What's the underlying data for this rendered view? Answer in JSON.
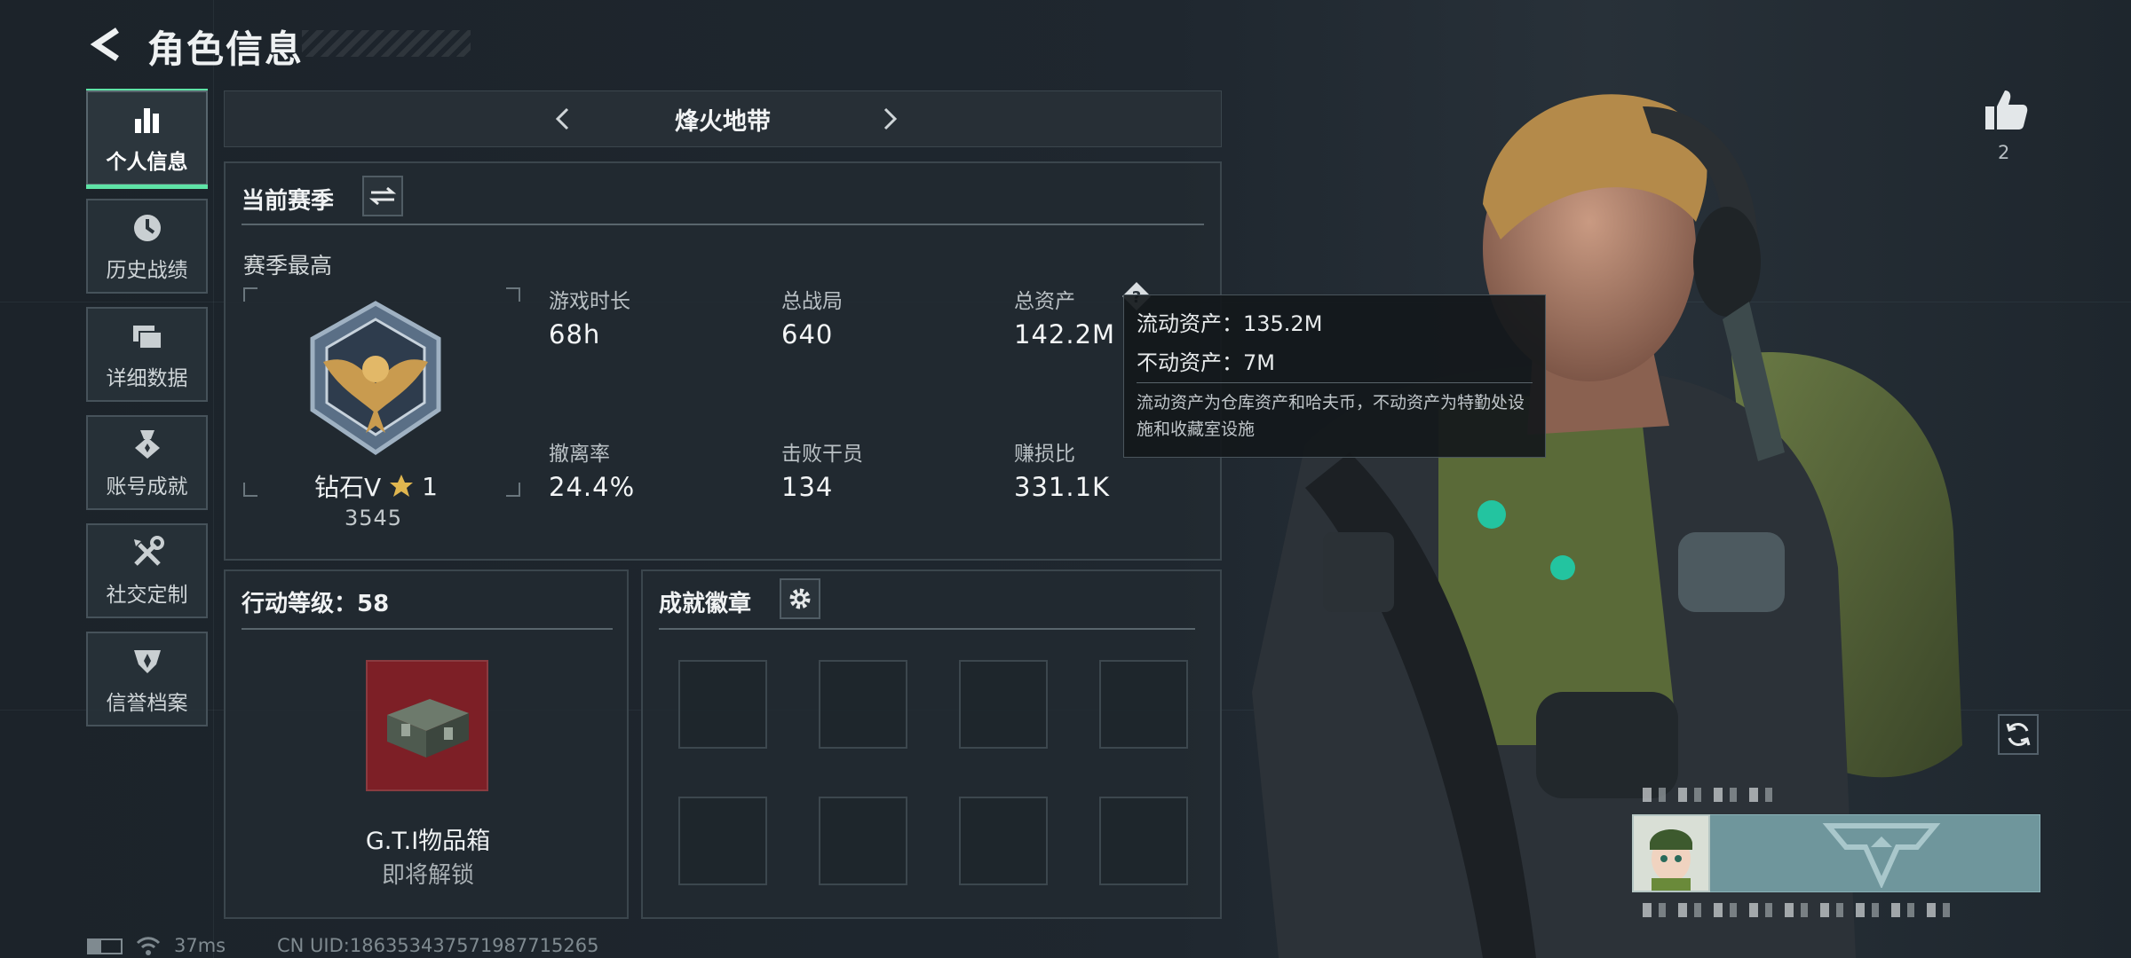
{
  "header": {
    "title": "角色信息"
  },
  "sidebar": {
    "items": [
      {
        "label": "个人信息",
        "icon": "bar-chart-icon",
        "active": true
      },
      {
        "label": "历史战绩",
        "icon": "clock-icon",
        "active": false
      },
      {
        "label": "详细数据",
        "icon": "cards-icon",
        "active": false
      },
      {
        "label": "账号成就",
        "icon": "medal-icon",
        "active": false
      },
      {
        "label": "社交定制",
        "icon": "tools-icon",
        "active": false
      },
      {
        "label": "信誉档案",
        "icon": "shield-icon",
        "active": false
      }
    ]
  },
  "mode": {
    "name": "烽火地带"
  },
  "season": {
    "title": "当前赛季",
    "best_label": "赛季最高",
    "rank_name": "钻石V",
    "rank_stars": "1",
    "rank_points": "3545",
    "stats": [
      {
        "label": "游戏时长",
        "value": "68h"
      },
      {
        "label": "总战局",
        "value": "640"
      },
      {
        "label": "总资产",
        "value": "142.2M"
      },
      {
        "label": "撤离率",
        "value": "24.4%"
      },
      {
        "label": "击败干员",
        "value": "134"
      },
      {
        "label": "赚损比",
        "value": "331.1K"
      }
    ]
  },
  "tooltip": {
    "liquid": "流动资产：135.2M",
    "fixed": "不动资产：7M",
    "note": "流动资产为仓库资产和哈夫币，不动资产为特勤处设施和收藏室设施"
  },
  "action_level": {
    "title": "行动等级：58",
    "reward_name": "G.T.I物品箱",
    "reward_status": "即将解锁"
  },
  "achievements": {
    "title": "成就徽章"
  },
  "likes": {
    "count": "2"
  },
  "footer": {
    "ping": "37ms",
    "uid": "CN UID:18635343757198771526​5"
  },
  "colors": {
    "accent": "#5ee3a6",
    "reward_bg": "#7d1f26",
    "card_bg": "#6f969c"
  }
}
